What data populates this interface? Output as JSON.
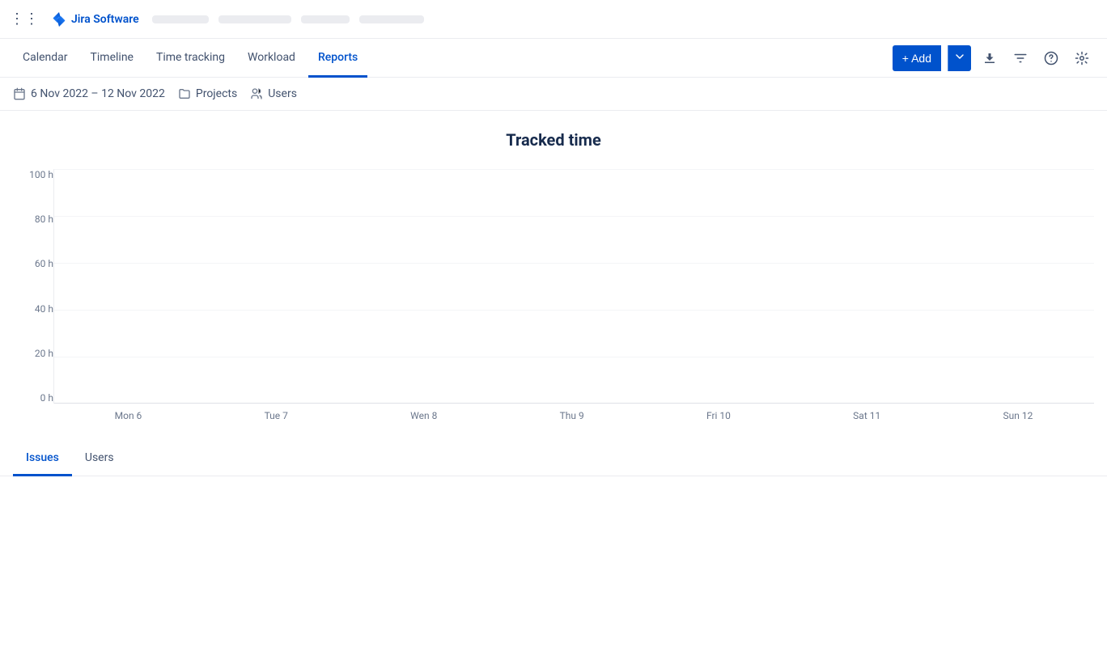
{
  "topBar": {
    "gridIcon": "⊞",
    "brand": "Jira Software",
    "skeletons": [
      60,
      80,
      55,
      75
    ]
  },
  "nav": {
    "tabs": [
      {
        "id": "calendar",
        "label": "Calendar",
        "active": false
      },
      {
        "id": "timeline",
        "label": "Timeline",
        "active": false
      },
      {
        "id": "time-tracking",
        "label": "Time tracking",
        "active": false
      },
      {
        "id": "workload",
        "label": "Workload",
        "active": false
      },
      {
        "id": "reports",
        "label": "Reports",
        "active": true
      }
    ],
    "addButton": "+ Add",
    "icons": {
      "download": "⬇",
      "filter": "⊟",
      "help": "?",
      "settings": "⚙"
    }
  },
  "filterBar": {
    "dateRange": "6 Nov 2022 – 12 Nov 2022",
    "projects": "Projects",
    "users": "Users"
  },
  "chart": {
    "title": "Tracked time",
    "yAxis": [
      "100 h",
      "80 h",
      "60 h",
      "40 h",
      "20 h",
      "0 h"
    ],
    "xAxis": [
      "Mon 6",
      "Tue 7",
      "Wen 8",
      "Thu 9",
      "Fri 10",
      "Sat 11",
      "Sun 12"
    ]
  },
  "bottomTabs": [
    {
      "id": "issues",
      "label": "Issues",
      "active": true
    },
    {
      "id": "users",
      "label": "Users",
      "active": false
    }
  ]
}
